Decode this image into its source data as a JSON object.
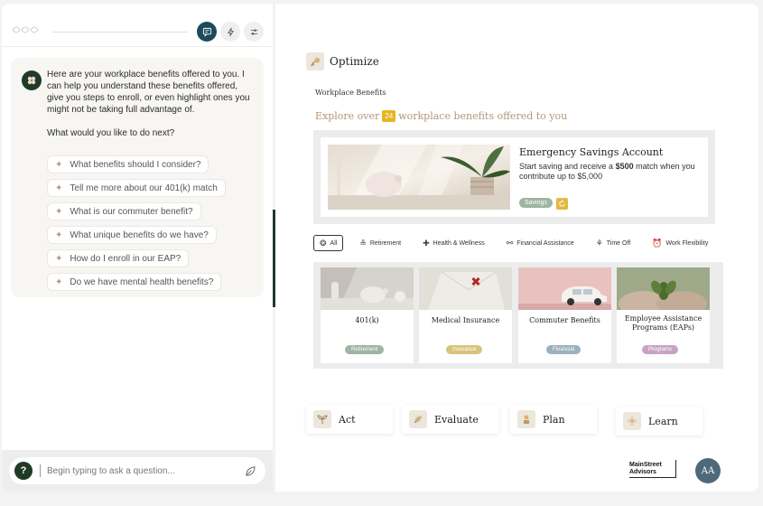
{
  "chat": {
    "intro": "Here are your workplace benefits offered to you. I can help you understand these benefits offered, give you steps to enroll, or even highlight ones you might not be taking full advantage of.",
    "question": "What would you like to do next?",
    "suggestions": [
      "What benefits should I consider?",
      "Tell me more about our 401(k) match",
      "What is our commuter benefit?",
      "What unique benefits do we have?",
      "How do I enroll in our EAP?",
      "Do we have mental health benefits?"
    ],
    "help_label": "?",
    "input_placeholder": "Begin typing to ask a question..."
  },
  "main": {
    "section_title": "Optimize",
    "subheading": "Workplace Benefits",
    "explore_prefix": "Explore over",
    "explore_count": "24",
    "explore_suffix": "workplace benefits offered to you",
    "featured": {
      "title": "Emergency Savings Account",
      "desc_prefix": "Start saving and receive a ",
      "desc_bold": "$500",
      "desc_suffix": " match when you contribute up to $5,000",
      "tag": "Savings"
    },
    "filters": [
      {
        "label": "All",
        "icon": "all-icon",
        "active": true
      },
      {
        "label": "Retirement",
        "icon": "sunset-icon"
      },
      {
        "label": "Health & Wellness",
        "icon": "health-cross-icon"
      },
      {
        "label": "Financial Assistance",
        "icon": "hand-money-icon"
      },
      {
        "label": "Time Off",
        "icon": "palm-tree-icon"
      },
      {
        "label": "Work Flexibility",
        "icon": "clock-icon"
      }
    ],
    "cards": [
      {
        "name": "401(k)",
        "tag": "Retirement",
        "tag_color": "#9fb4a2"
      },
      {
        "name": "Medical Insurance",
        "tag": "Insurance",
        "tag_color": "#d8c47a"
      },
      {
        "name": "Commuter Benefits",
        "tag": "Financial",
        "tag_color": "#9ab1bf"
      },
      {
        "name": "Employee Assistance Programs (EAPs)",
        "tag": "Programs",
        "tag_color": "#c9a3c6"
      }
    ],
    "nav": [
      {
        "label": "Act"
      },
      {
        "label": "Evaluate"
      },
      {
        "label": "Plan"
      },
      {
        "label": "Learn"
      }
    ]
  },
  "brand": {
    "logo_line1": "MainStreet",
    "logo_line2": "Advisors",
    "user_initials": "AA"
  },
  "colors": {
    "primary_dark": "#1d4b5e",
    "forest": "#1f3a2c",
    "accent_gold": "#e8b51e",
    "explore_text": "#b39578"
  }
}
